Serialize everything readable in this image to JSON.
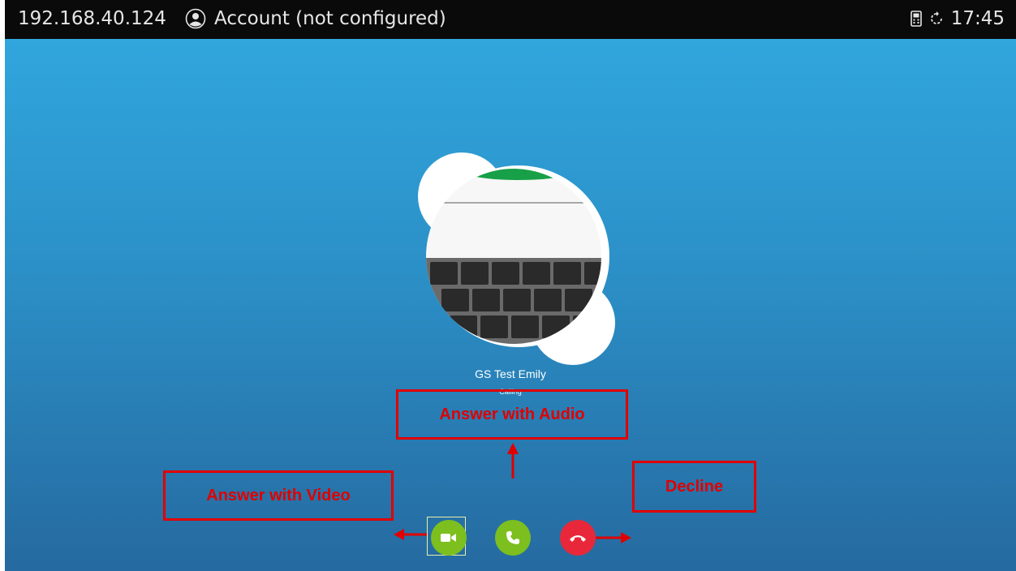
{
  "status_bar": {
    "ip_address": "192.168.40.124",
    "account_label": "Account (not configured)",
    "time": "17:45",
    "icons": [
      "account-icon",
      "phone-device-icon",
      "sync-icon"
    ]
  },
  "call": {
    "caller_name": "GS Test Emily",
    "status": "Calling"
  },
  "controls": {
    "answer_video": {
      "icon": "video-camera-icon",
      "color": "#7cbf1f"
    },
    "answer_audio": {
      "icon": "phone-icon",
      "color": "#7cbf1f"
    },
    "decline": {
      "icon": "hang-up-icon",
      "color": "#e8283a"
    }
  },
  "annotations": {
    "answer_audio": "Answer with Audio",
    "answer_video": "Answer with Video",
    "decline": "Decline",
    "color": "#e00000"
  }
}
